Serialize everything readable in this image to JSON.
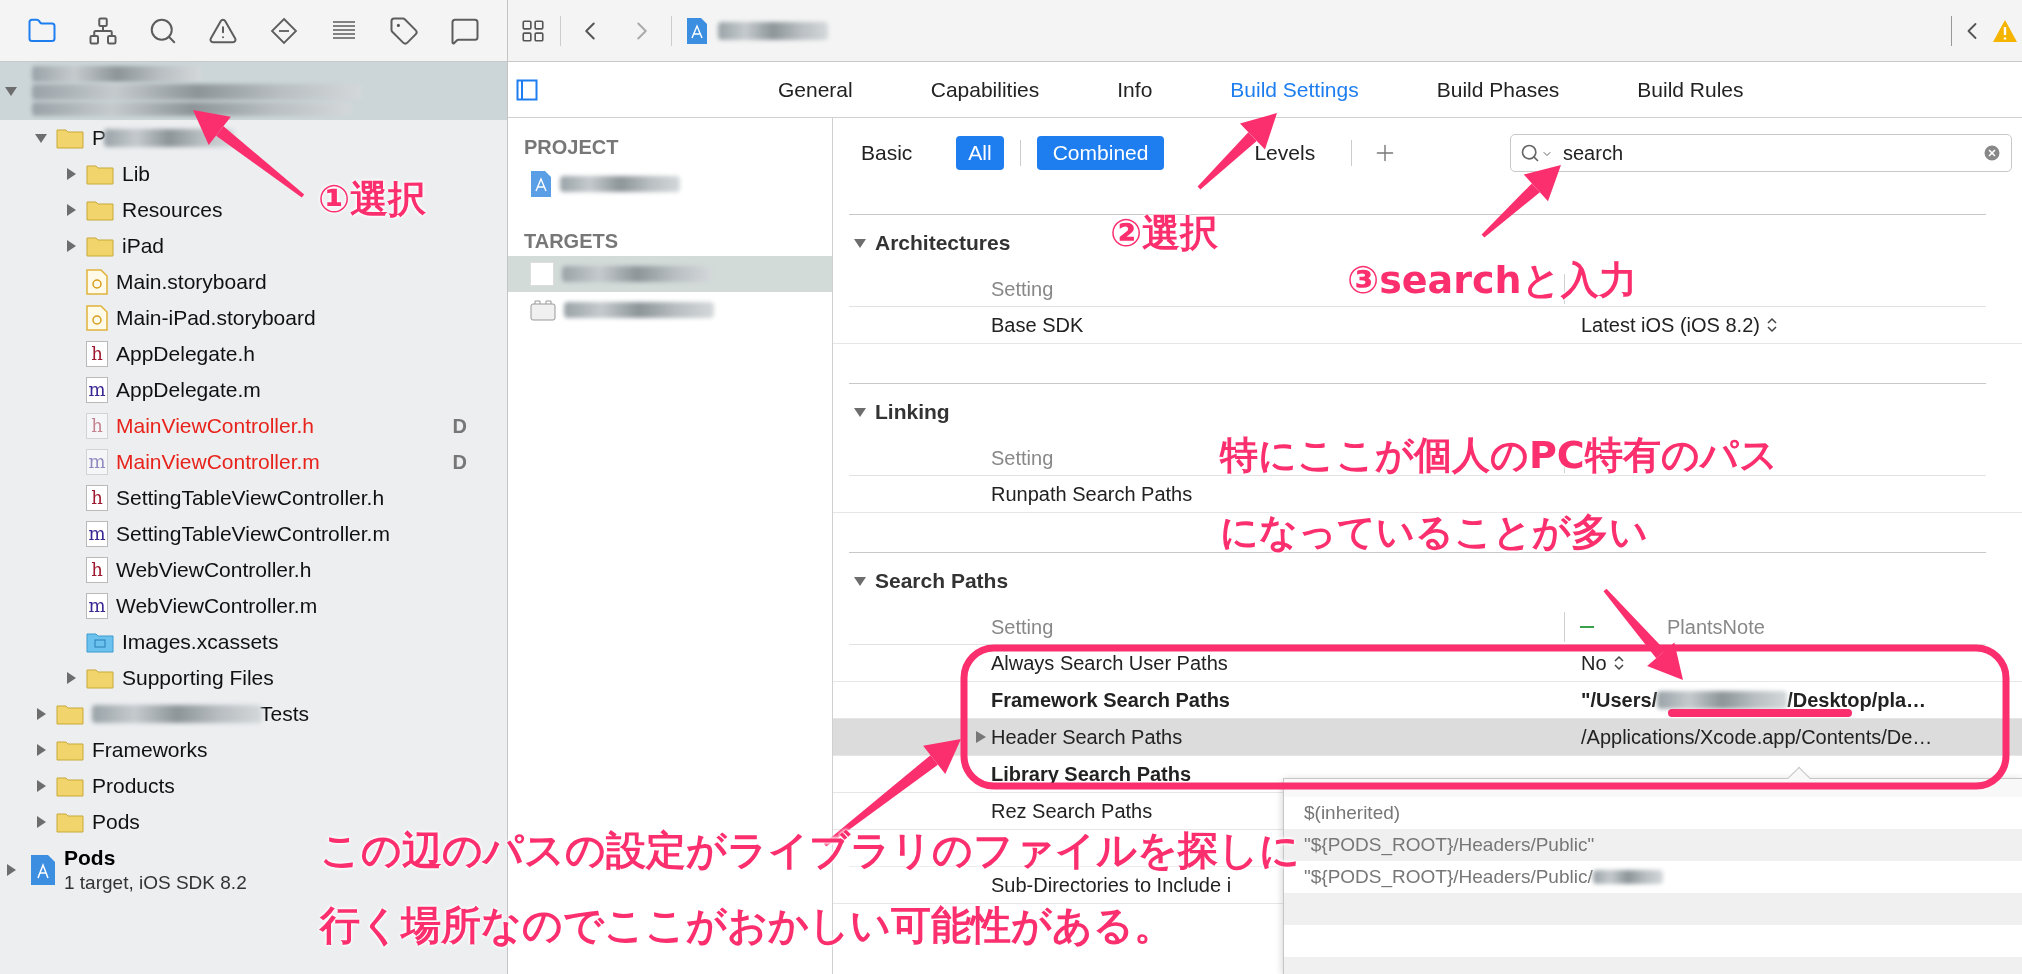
{
  "navigator_tabs": [
    {
      "kind": "files",
      "selected": true
    },
    {
      "kind": "hierarchy",
      "selected": false
    },
    {
      "kind": "search",
      "selected": false
    },
    {
      "kind": "issues",
      "selected": false
    },
    {
      "kind": "tests",
      "selected": false
    },
    {
      "kind": "debug",
      "selected": false
    },
    {
      "kind": "breakpoints",
      "selected": false
    },
    {
      "kind": "reports",
      "selected": false
    }
  ],
  "tree": [
    {
      "kind": "project",
      "selected": true,
      "expanded": true,
      "children": [
        {
          "kind": "folder",
          "label": "P",
          "redacted_suffix": true,
          "expanded": true,
          "children": [
            {
              "kind": "folder",
              "label": "Lib",
              "expanded": false
            },
            {
              "kind": "folder",
              "label": "Resources",
              "expanded": false
            },
            {
              "kind": "folder",
              "label": "iPad",
              "expanded": false
            },
            {
              "kind": "storyboard",
              "label": "Main.storyboard"
            },
            {
              "kind": "storyboard",
              "label": "Main-iPad.storyboard"
            },
            {
              "kind": "header",
              "icon_letter": "h",
              "label": "AppDelegate.h",
              "missing": false
            },
            {
              "kind": "implementation",
              "icon_letter": "m",
              "label": "AppDelegate.m",
              "missing": false
            },
            {
              "kind": "header",
              "icon_letter": "h",
              "label": "MainViewController.h",
              "missing": true,
              "status": "D"
            },
            {
              "kind": "implementation",
              "icon_letter": "m",
              "label": "MainViewController.m",
              "missing": true,
              "status": "D"
            },
            {
              "kind": "header",
              "icon_letter": "h",
              "label": "SettingTableViewController.h",
              "missing": false
            },
            {
              "kind": "implementation",
              "icon_letter": "m",
              "label": "SettingTableViewController.m",
              "missing": false
            },
            {
              "kind": "header",
              "icon_letter": "h",
              "label": "WebViewController.h",
              "missing": false
            },
            {
              "kind": "implementation",
              "icon_letter": "m",
              "label": "WebViewController.m",
              "missing": false
            },
            {
              "kind": "assets",
              "label": "Images.xcassets"
            },
            {
              "kind": "folder",
              "label": "Supporting Files",
              "expanded": false
            }
          ]
        },
        {
          "kind": "folder",
          "label": "Tests",
          "redacted_prefix": true,
          "expanded": false
        },
        {
          "kind": "folder",
          "label": "Frameworks",
          "expanded": false
        },
        {
          "kind": "folder",
          "label": "Products",
          "expanded": false
        },
        {
          "kind": "folder",
          "label": "Pods",
          "expanded": false
        }
      ]
    },
    {
      "kind": "project",
      "label": "Pods",
      "subtitle": "1 target, iOS SDK 8.2",
      "selected": false,
      "expanded": false
    }
  ],
  "editor_tabs": [
    {
      "label": "General",
      "selected": false
    },
    {
      "label": "Capabilities",
      "selected": false
    },
    {
      "label": "Info",
      "selected": false
    },
    {
      "label": "Build Settings",
      "selected": true
    },
    {
      "label": "Build Phases",
      "selected": false
    },
    {
      "label": "Build Rules",
      "selected": false
    }
  ],
  "sidebar": {
    "project_header": "PROJECT",
    "targets_header": "TARGETS",
    "targets": [
      {
        "kind": "app",
        "selected": true
      },
      {
        "kind": "tests",
        "selected": false
      }
    ]
  },
  "scope_filters": [
    {
      "label": "Basic",
      "selected": false
    },
    {
      "label": "All",
      "selected": true
    }
  ],
  "view_filters": [
    {
      "label": "Combined",
      "selected": true
    },
    {
      "label": "Levels",
      "selected": false
    }
  ],
  "search": {
    "value": "search"
  },
  "sections": [
    {
      "title": "Architectures",
      "expanded": true,
      "column_header": "Setting",
      "rows": [
        {
          "label": "Base SDK",
          "value": "Latest iOS (iOS 8.2)",
          "stepper": true,
          "bold": false,
          "selected": false
        }
      ]
    },
    {
      "title": "Linking",
      "expanded": true,
      "column_header": "Setting",
      "rows": [
        {
          "label": "Runpath Search Paths",
          "bold": false,
          "selected": false
        }
      ]
    },
    {
      "title": "Search Paths",
      "expanded": true,
      "column_header": "Setting",
      "target_label": "PlantsNote",
      "rows": [
        {
          "label": "Always Search User Paths",
          "value": "No",
          "stepper": true,
          "bold": false,
          "selected": false
        },
        {
          "label": "Framework Search Paths",
          "value": "\"/Users/",
          "value_end": "/Desktop/pla…",
          "bold": true,
          "selected": false
        },
        {
          "label": "Header Search Paths",
          "value": "/Applications/Xcode.app/Contents/De…",
          "bold": false,
          "selected": true
        },
        {
          "label": "Library Search Paths",
          "bold": true,
          "selected": false
        },
        {
          "label": "Rez Search Paths",
          "bold": false,
          "selected": false
        },
        {
          "kind": "covered"
        },
        {
          "label": "Sub-Directories to Include i",
          "bold": false,
          "selected": false
        }
      ]
    }
  ],
  "popover": {
    "values": [
      {
        "text": "$(inherited)"
      },
      {
        "text": "\"${PODS_ROOT}/Headers/Public\""
      },
      {
        "text": "\"${PODS_ROOT}/Headers/Public/",
        "redacted": true
      }
    ]
  },
  "callouts": [
    {
      "lines": [
        "①選択"
      ]
    },
    {
      "lines": [
        "②選択"
      ]
    },
    {
      "lines": [
        "③searchと入力"
      ]
    },
    {
      "lines": [
        "特にここが個人のPC特有のパス",
        "になっていることが多い"
      ]
    },
    {
      "lines": [
        "この辺のパスの設定がライブラリのファイルを探しに",
        "行く場所なのでここがおかしい可能性がある。"
      ]
    }
  ]
}
